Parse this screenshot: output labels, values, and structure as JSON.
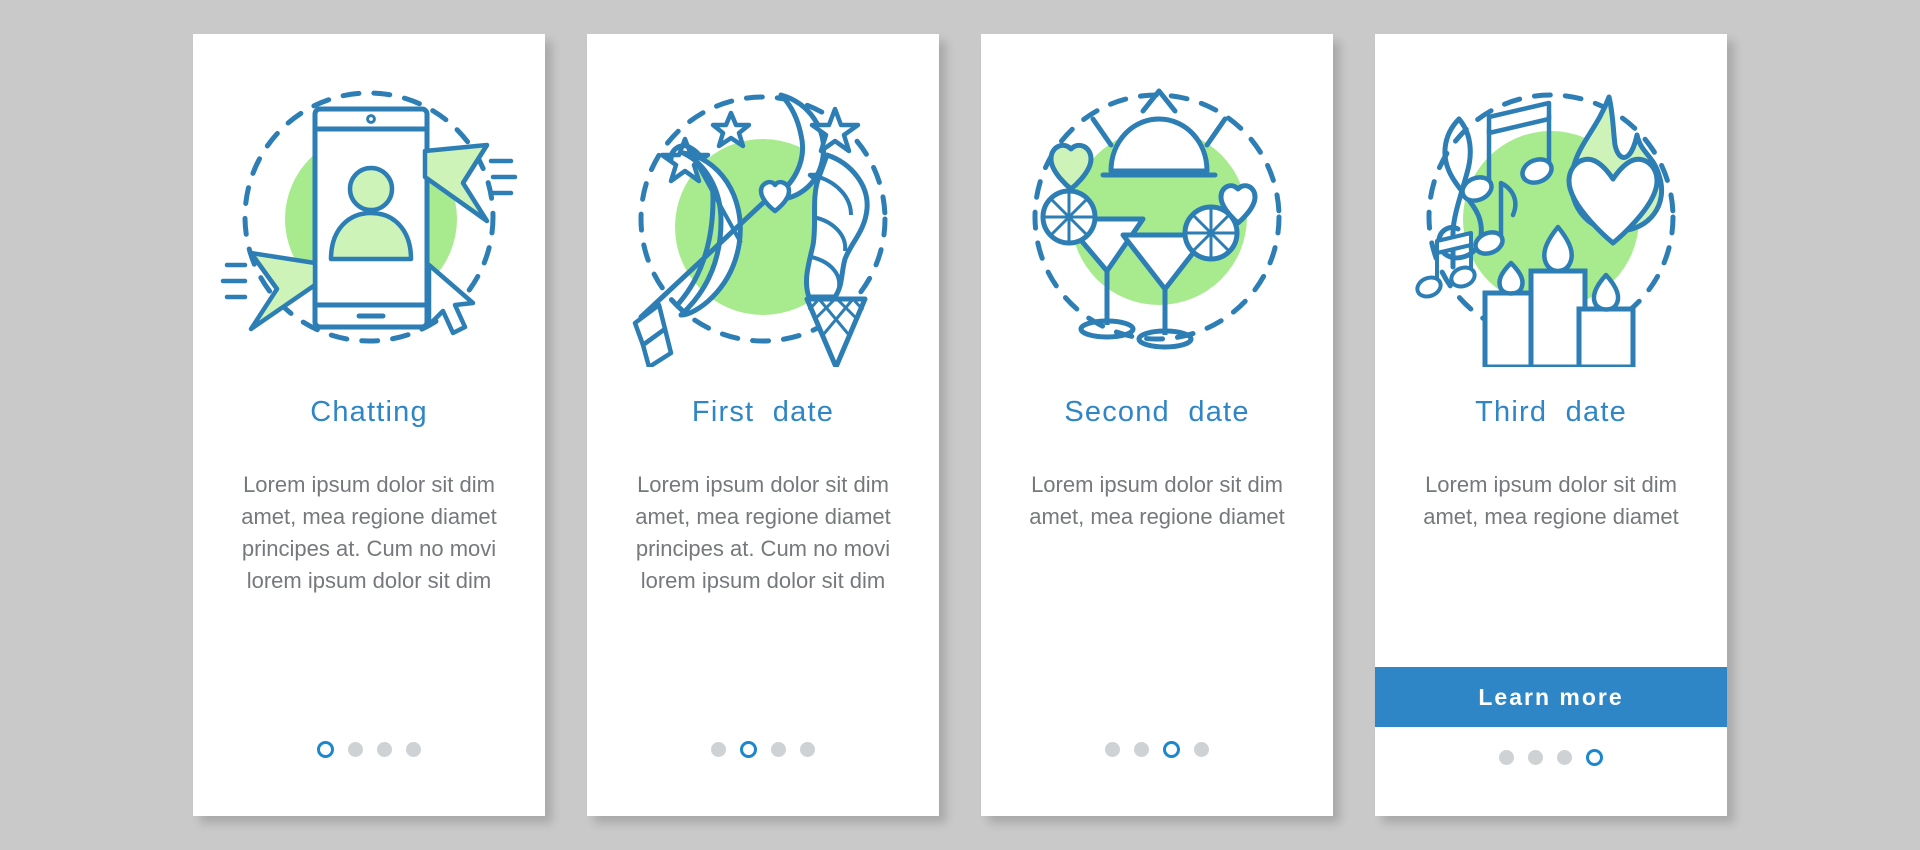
{
  "page": {
    "background_color": "#c9c9c9",
    "card_background": "#ffffff",
    "accent_color": "#2f86c6",
    "line_color": "#2d7eb5",
    "green_color": "#a8eb8e",
    "body_text_color": "#76797c",
    "dot_inactive_color": "#cfd2d4",
    "dot_active_color": "#1b87cf"
  },
  "screens": [
    {
      "id": "chatting",
      "title": "Chatting",
      "body": "Lorem ipsum dolor sit dim amet, mea regione diamet principes at. Cum no movi lorem ipsum dolor sit dim",
      "illustration": "tablet-cursors-icon",
      "dots": {
        "count": 4,
        "active_index": 0
      },
      "cta": null
    },
    {
      "id": "first-date",
      "title": "First  date",
      "body": "Lorem ipsum dolor sit dim amet, mea regione diamet principes at. Cum no movi lorem ipsum dolor sit dim",
      "illustration": "moon-stars-bow-icecream-icon",
      "dots": {
        "count": 4,
        "active_index": 1
      },
      "cta": null
    },
    {
      "id": "second-date",
      "title": "Second  date",
      "body": "Lorem ipsum dolor sit dim amet, mea regione diamet",
      "illustration": "cocktails-hearts-icon",
      "dots": {
        "count": 4,
        "active_index": 2
      },
      "cta": null
    },
    {
      "id": "third-date",
      "title": "Third  date",
      "body": "Lorem ipsum dolor sit dim amet, mea regione diamet",
      "illustration": "candles-music-heart-icon",
      "dots": {
        "count": 4,
        "active_index": 3
      },
      "cta": {
        "label": "Learn  more"
      }
    }
  ]
}
